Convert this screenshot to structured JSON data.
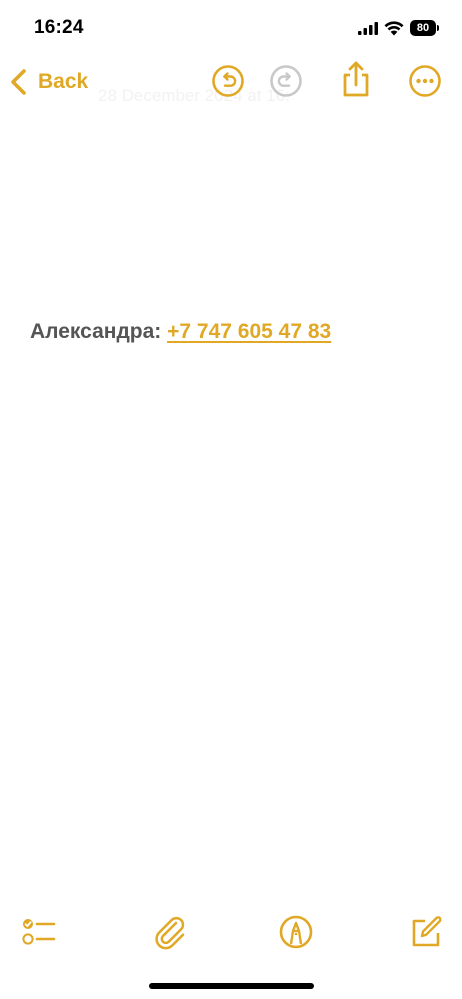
{
  "status_bar": {
    "time": "16:24",
    "battery": "80"
  },
  "nav": {
    "back_label": "Back",
    "date_text": "28 December 2024 at 16:"
  },
  "note": {
    "name": "Александра:",
    "phone": "+7 747 605 47 83"
  },
  "colors": {
    "accent": "#e0a825",
    "body_text": "#555555",
    "disabled": "#c8c8c8"
  },
  "icons": {
    "undo": "undo-icon",
    "redo": "redo-icon",
    "share": "share-icon",
    "more": "more-icon",
    "checklist": "checklist-icon",
    "attach": "paperclip-icon",
    "markup": "markup-icon",
    "compose": "compose-icon"
  }
}
